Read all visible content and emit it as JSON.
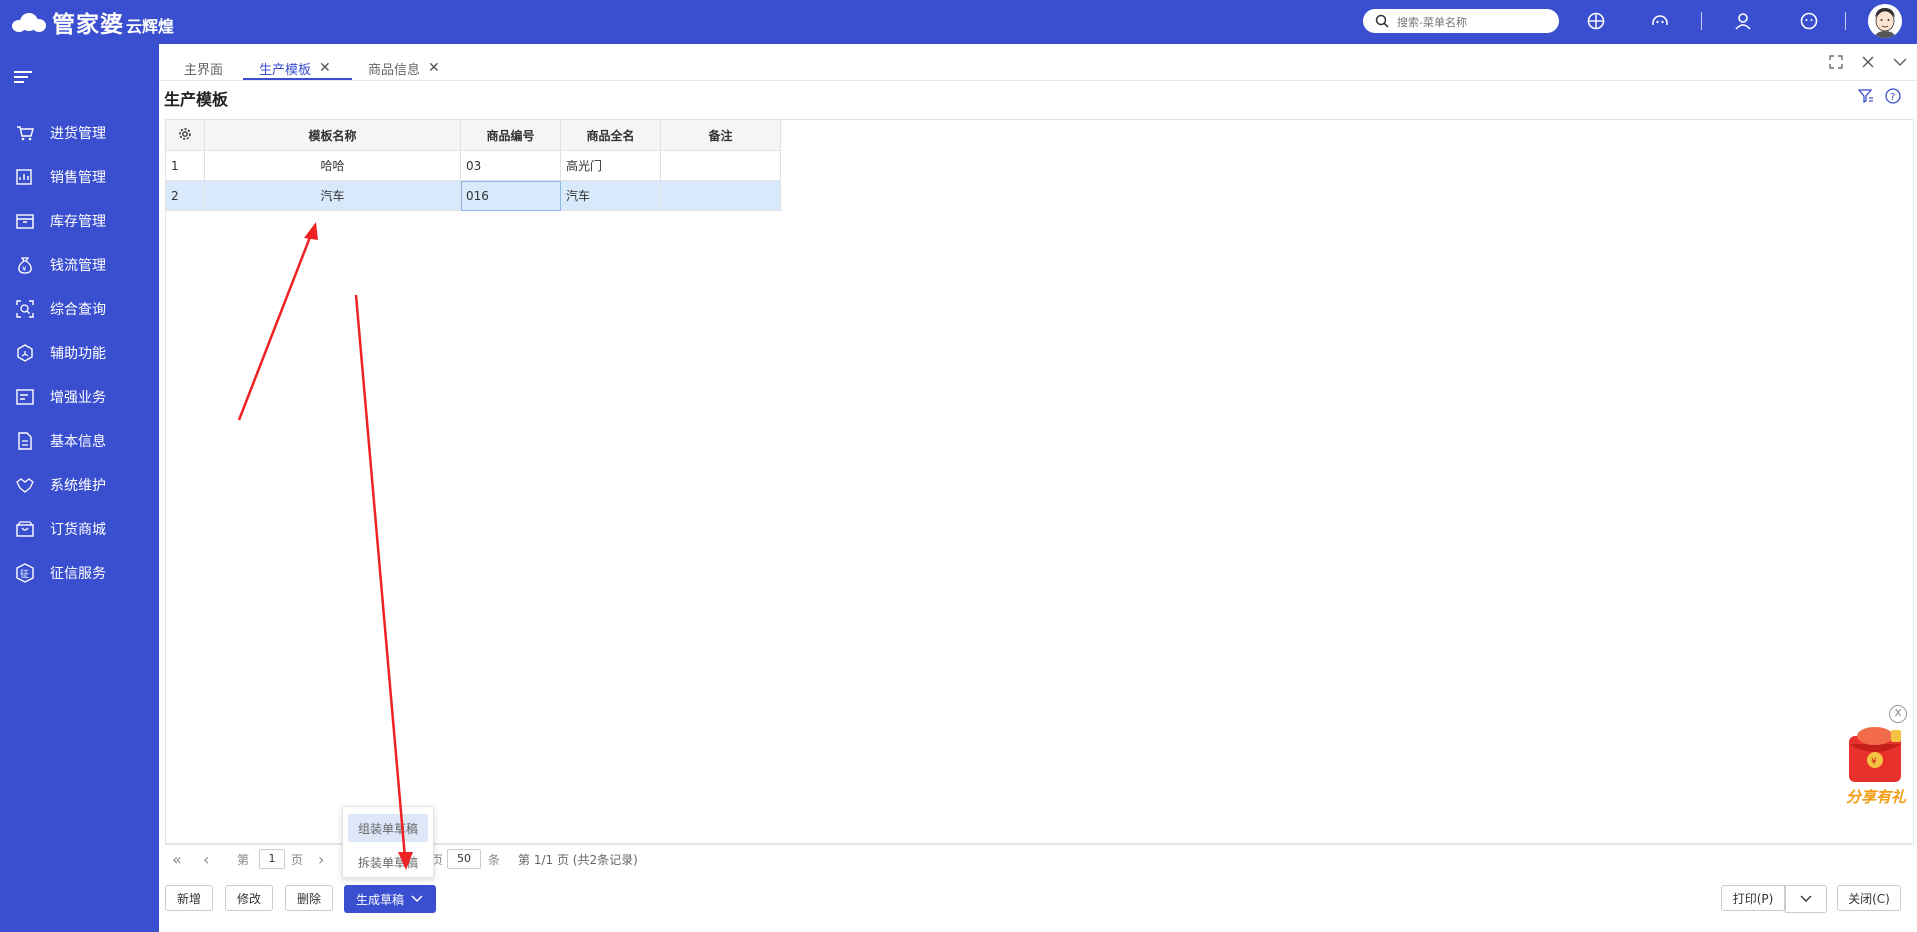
{
  "header": {
    "brand": "管家婆",
    "product": "云辉煌",
    "search_placeholder": "搜索-菜单名称"
  },
  "sidebar": {
    "items": [
      {
        "label": "进货管理",
        "icon": "cart-icon"
      },
      {
        "label": "销售管理",
        "icon": "sales-chart-icon"
      },
      {
        "label": "库存管理",
        "icon": "box-icon"
      },
      {
        "label": "钱流管理",
        "icon": "money-bag-icon"
      },
      {
        "label": "综合查询",
        "icon": "query-icon"
      },
      {
        "label": "辅助功能",
        "icon": "hexagon-tool-icon"
      },
      {
        "label": "增强业务",
        "icon": "list-board-icon"
      },
      {
        "label": "基本信息",
        "icon": "document-icon"
      },
      {
        "label": "系统维护",
        "icon": "handshake-icon"
      },
      {
        "label": "订货商城",
        "icon": "shop-icon"
      },
      {
        "label": "征信服务",
        "icon": "credit-badge-icon"
      }
    ]
  },
  "tabs": [
    {
      "label": "主界面",
      "closable": false
    },
    {
      "label": "生产模板",
      "closable": true,
      "active": true
    },
    {
      "label": "商品信息",
      "closable": true
    }
  ],
  "page": {
    "title": "生产模板"
  },
  "grid": {
    "columns": [
      "模板名称",
      "商品编号",
      "商品全名",
      "备注"
    ],
    "rows": [
      {
        "index": "1",
        "name": "哈哈",
        "code": "03",
        "full_name": "高光门",
        "remark": ""
      },
      {
        "index": "2",
        "name": "汽车",
        "code": "016",
        "full_name": "汽车",
        "remark": "",
        "selected": true
      }
    ]
  },
  "pager": {
    "page_prefix": "第",
    "page_value": "1",
    "page_suffix": "页",
    "page_size_prefix": "页",
    "page_size": "50",
    "page_size_suffix": "条",
    "summary": "第 1/1 页 (共2条记录)"
  },
  "dropdown": {
    "items": [
      "组装单草稿",
      "拆装单草稿"
    ]
  },
  "buttons": {
    "add": "新增",
    "edit": "修改",
    "delete": "删除",
    "generate": "生成草稿",
    "print": "打印(P)",
    "close": "关闭(C)"
  },
  "promo": {
    "label": "分享有礼",
    "close": "X"
  },
  "colors": {
    "primary": "#3a4fcf",
    "selected_row": "#d8e9fb",
    "arrow": "#ee2222",
    "promo": "#f39c12"
  }
}
